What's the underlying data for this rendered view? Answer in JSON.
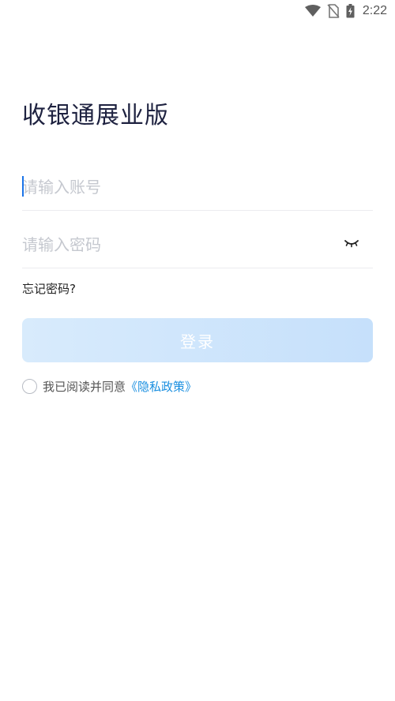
{
  "status_bar": {
    "time": "2:22",
    "icons": [
      "wifi-icon",
      "no-sim-icon",
      "battery-charging-icon"
    ]
  },
  "login": {
    "title": "收银通展业版",
    "account_placeholder": "请输入账号",
    "account_value": "",
    "password_placeholder": "请输入密码",
    "password_value": "",
    "password_toggle_icon": "eye-closed-icon",
    "forgot_password": "忘记密码?",
    "login_button": "登录",
    "agreement_text": "我已阅读并同意",
    "privacy_link": "《隐私政策》",
    "agreement_checked": false
  },
  "colors": {
    "title": "#1e2240",
    "placeholder": "#c5c8cf",
    "button_bg": "#cfe5fb",
    "link": "#1a8fe0",
    "caret": "#1a73e8"
  }
}
